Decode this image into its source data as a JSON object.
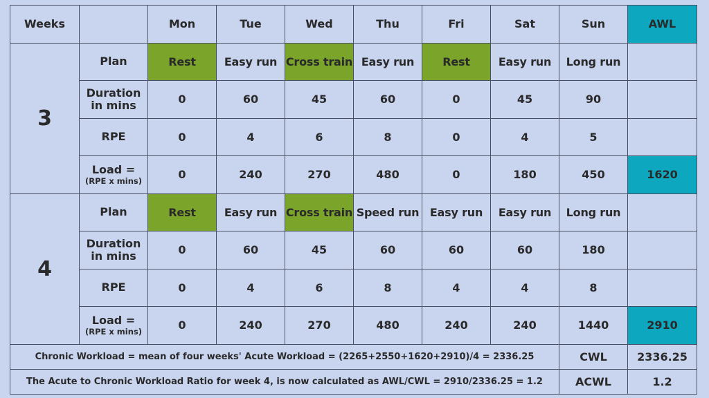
{
  "header": {
    "weeks_label": "Weeks",
    "blank": "",
    "days": [
      "Mon",
      "Tue",
      "Wed",
      "Thu",
      "Fri",
      "Sat",
      "Sun"
    ],
    "awl_label": "AWL"
  },
  "row_labels": {
    "plan": "Plan",
    "duration_line1": "Duration",
    "duration_line2": "in mins",
    "rpe": "RPE",
    "load_line1": "Load =",
    "load_line2": "(RPE x mins)"
  },
  "weeks": [
    {
      "week": "3",
      "plan": [
        "Rest",
        "Easy run",
        "Cross train",
        "Easy run",
        "Rest",
        "Easy run",
        "Long run"
      ],
      "duration": [
        "0",
        "60",
        "45",
        "60",
        "0",
        "45",
        "90"
      ],
      "rpe": [
        "0",
        "4",
        "6",
        "8",
        "0",
        "4",
        "5"
      ],
      "load": [
        "0",
        "240",
        "270",
        "480",
        "0",
        "180",
        "450"
      ],
      "awl": "1620"
    },
    {
      "week": "4",
      "plan": [
        "Rest",
        "Easy run",
        "Cross train",
        "Speed run",
        "Easy run",
        "Easy run",
        "Long run"
      ],
      "duration": [
        "0",
        "60",
        "45",
        "60",
        "60",
        "60",
        "180"
      ],
      "rpe": [
        "0",
        "4",
        "6",
        "8",
        "4",
        "4",
        "8"
      ],
      "load": [
        "0",
        "240",
        "270",
        "480",
        "240",
        "240",
        "1440"
      ],
      "awl": "2910"
    }
  ],
  "footer": {
    "cwl_text": "Chronic Workload  = mean of four weeks' Acute Workload = (2265+2550+1620+2910)/4 = 2336.25",
    "cwl_label": "CWL",
    "cwl_value": "2336.25",
    "acwl_text": "The Acute to Chronic Workload Ratio for week 4, is now calculated as AWL/CWL = 2910/2336.25 = 1.2",
    "acwl_label": "ACWL",
    "acwl_value": "1.2"
  },
  "colors": {
    "background": "#c9d4ef",
    "rest_highlight": "#7ba42a",
    "awl_highlight": "#0da8c0",
    "border": "#4a5063"
  }
}
